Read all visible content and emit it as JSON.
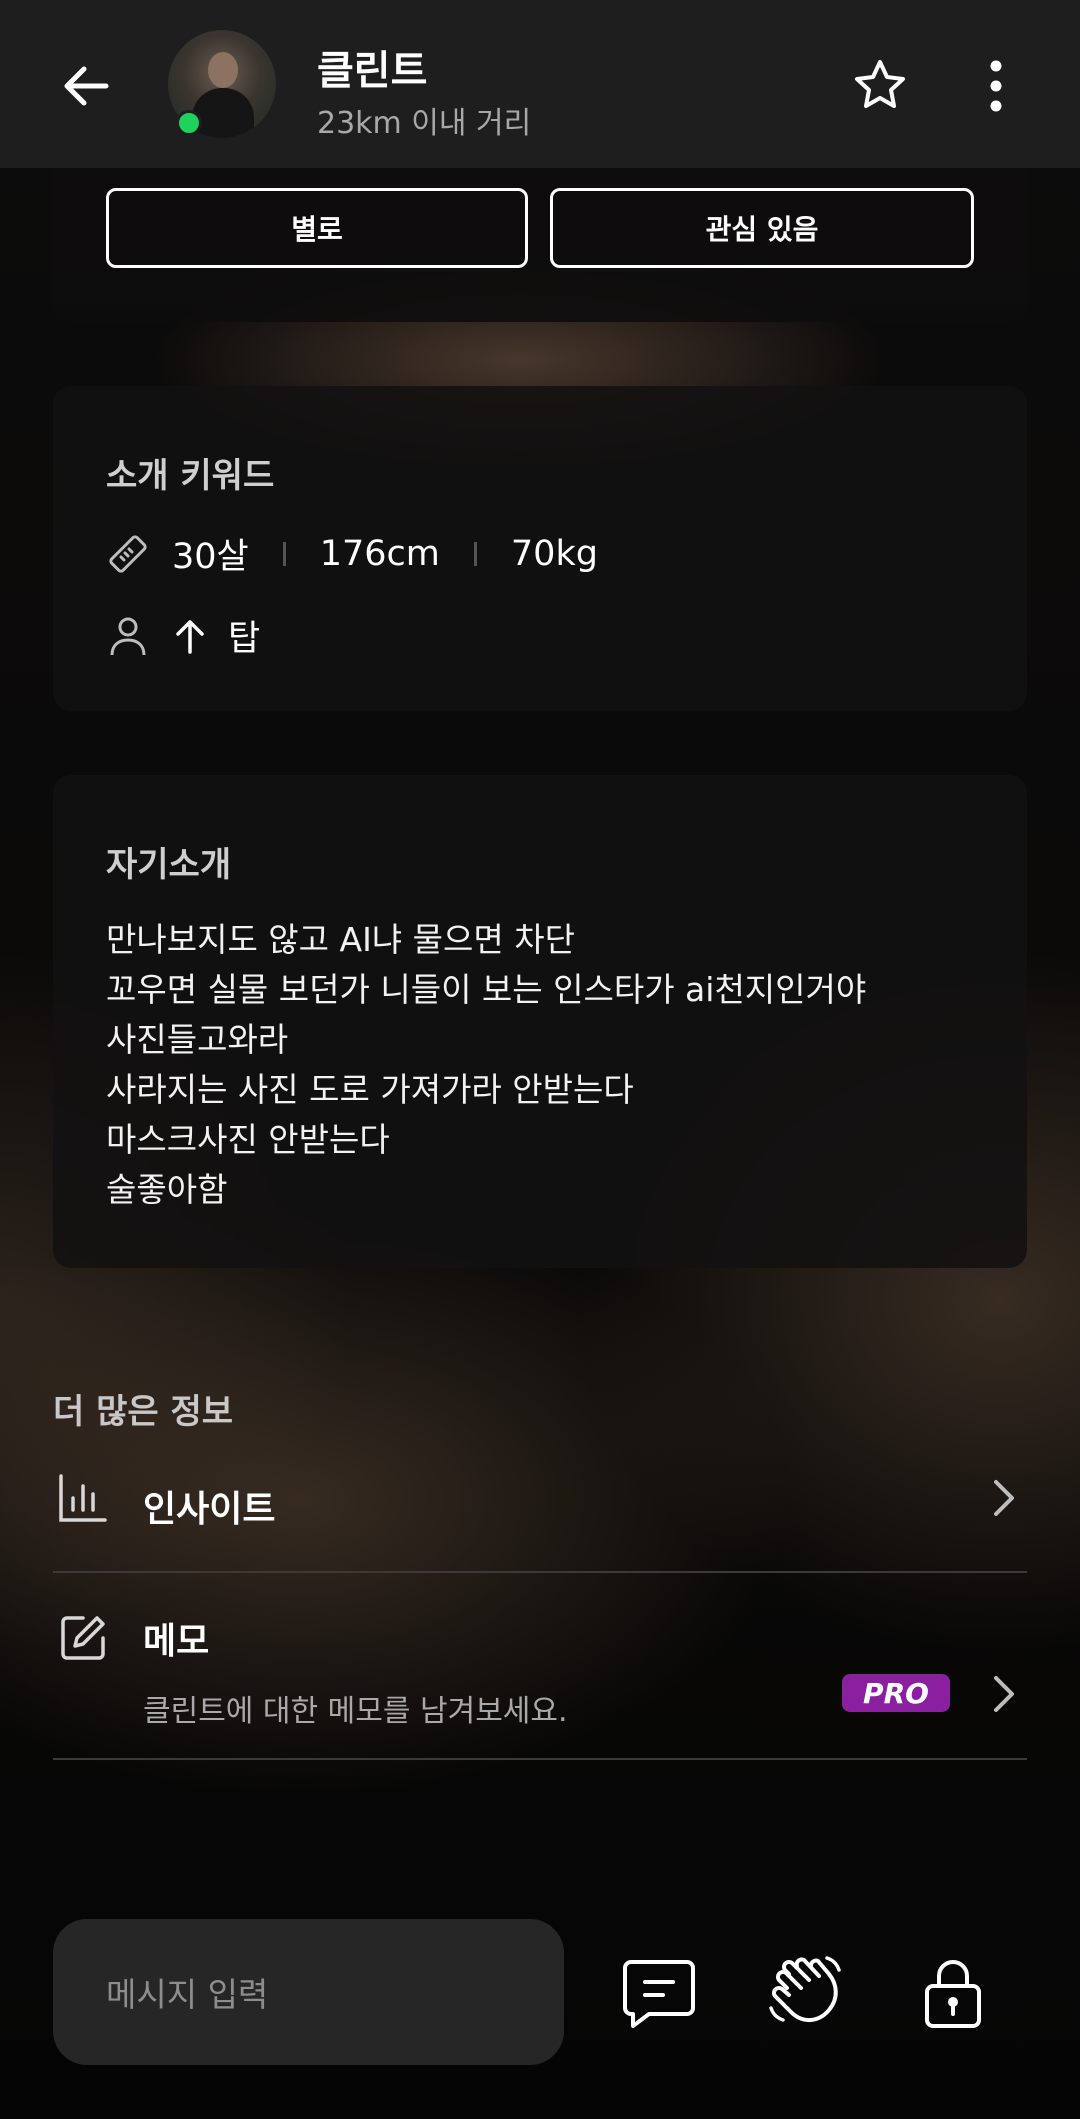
{
  "header": {
    "name": "클린트",
    "distance": "23km 이내 거리",
    "icons": {
      "back": "arrow-left-icon",
      "favorite": "star-icon",
      "more": "more-vertical-icon"
    },
    "online_color": "#1fd25c"
  },
  "reaction": {
    "dislike_label": "별로",
    "like_label": "관심 있음"
  },
  "keywords": {
    "title": "소개 키워드",
    "body": [
      "30살",
      "176cm",
      "70kg"
    ],
    "position_label": "탑"
  },
  "intro": {
    "title": "자기소개",
    "text": "만나보지도 않고 AI냐 물으면 차단\n꼬우면 실물 보던가 니들이 보는 인스타가 ai천지인거야\n사진들고와라\n사라지는 사진 도로 가져가라 안받는다\n마스크사진 안받는다\n술좋아함"
  },
  "more_info": {
    "title": "더 많은 정보",
    "insight_label": "인사이트",
    "memo_label": "메모",
    "memo_sub": "클린트에 대한 메모를 남겨보세요.",
    "pro_badge": "PRO",
    "pro_color": "#8a1fa0"
  },
  "composer": {
    "placeholder": "메시지 입력",
    "icons": [
      "chat-icon",
      "wave-hand-icon",
      "lock-icon"
    ]
  }
}
